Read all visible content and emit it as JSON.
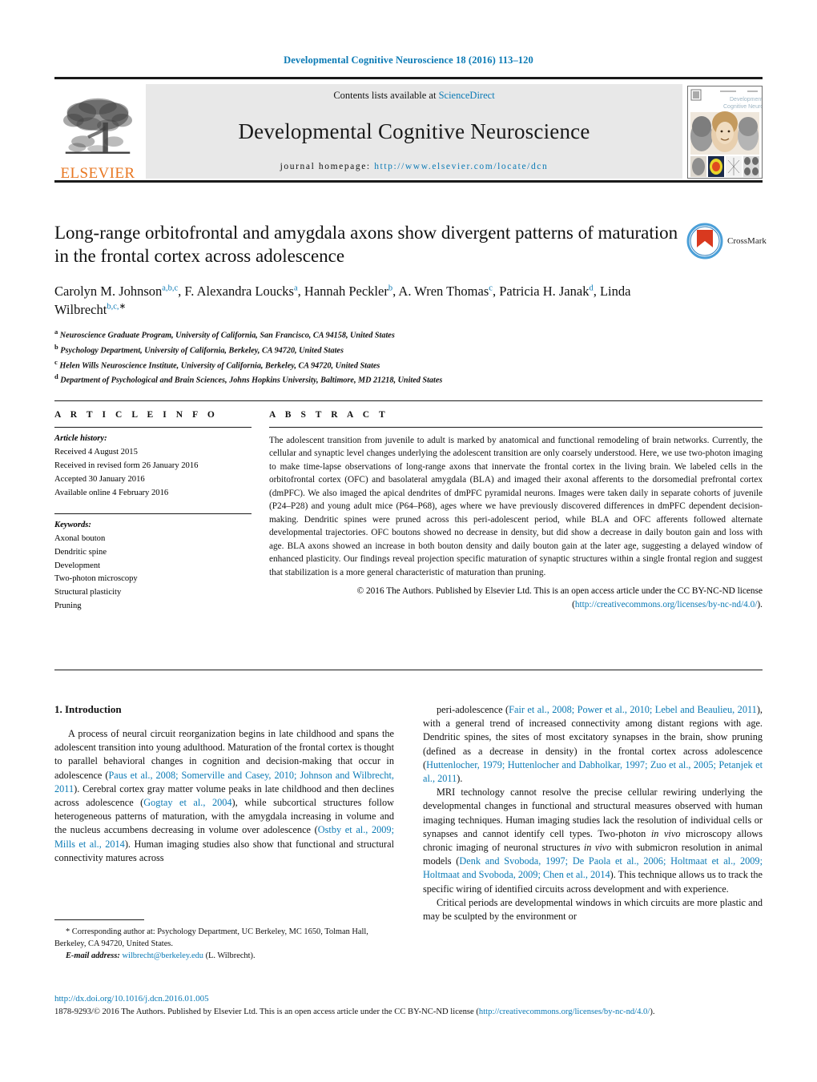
{
  "running_head": "Developmental Cognitive Neuroscience 18 (2016) 113–120",
  "masthead": {
    "contents_prefix": "Contents lists available at ",
    "contents_link": "ScienceDirect",
    "journal_title": "Developmental Cognitive Neuroscience",
    "homepage_prefix": "journal homepage: ",
    "homepage_link": "http://www.elsevier.com/locate/dcn",
    "publisher_wordmark": "ELSEVIER",
    "publisher_logo_icon": "elsevier-tree-icon",
    "cover_icon": "journal-cover-thumbnail"
  },
  "crossmark": {
    "label": "CrossMark",
    "icon": "crossmark-icon"
  },
  "article": {
    "title": "Long-range orbitofrontal and amygdala axons show divergent patterns of maturation in the frontal cortex across adolescence",
    "authors_html": "Carolyn M. Johnson<sup>a,b,c</sup>, F. Alexandra Loucks<sup>a</sup>, Hannah Peckler<sup>b</sup>, A. Wren Thomas<sup>c</sup>, Patricia H. Janak<sup>d</sup>, Linda Wilbrecht<sup>b,c,</sup><sup style=\"color:#111\">∗</sup>",
    "affiliations": [
      {
        "marker": "a",
        "text": "Neuroscience Graduate Program, University of California, San Francisco, CA 94158, United States"
      },
      {
        "marker": "b",
        "text": "Psychology Department, University of California, Berkeley, CA 94720, United States"
      },
      {
        "marker": "c",
        "text": "Helen Wills Neuroscience Institute, University of California, Berkeley, CA 94720, United States"
      },
      {
        "marker": "d",
        "text": "Department of Psychological and Brain Sciences, Johns Hopkins University, Baltimore, MD 21218, United States"
      }
    ]
  },
  "article_info": {
    "heading": "A R T I C L E    I N F O",
    "history_label": "Article history:",
    "history": [
      "Received 4 August 2015",
      "Received in revised form 26 January 2016",
      "Accepted 30 January 2016",
      "Available online 4 February 2016"
    ],
    "keywords_label": "Keywords:",
    "keywords": [
      "Axonal bouton",
      "Dendritic spine",
      "Development",
      "Two-photon microscopy",
      "Structural plasticity",
      "Pruning"
    ]
  },
  "abstract": {
    "heading": "A B S T R A C T",
    "body": "The adolescent transition from juvenile to adult is marked by anatomical and functional remodeling of brain networks. Currently, the cellular and synaptic level changes underlying the adolescent transition are only coarsely understood. Here, we use two-photon imaging to make time-lapse observations of long-range axons that innervate the frontal cortex in the living brain. We labeled cells in the orbitofrontal cortex (OFC) and basolateral amygdala (BLA) and imaged their axonal afferents to the dorsomedial prefrontal cortex (dmPFC). We also imaged the apical dendrites of dmPFC pyramidal neurons. Images were taken daily in separate cohorts of juvenile (P24–P28) and young adult mice (P64–P68), ages where we have previously discovered differences in dmPFC dependent decision-making. Dendritic spines were pruned across this peri-adolescent period, while BLA and OFC afferents followed alternate developmental trajectories. OFC boutons showed no decrease in density, but did show a decrease in daily bouton gain and loss with age. BLA axons showed an increase in both bouton density and daily bouton gain at the later age, suggesting a delayed window of enhanced plasticity. Our findings reveal projection specific maturation of synaptic structures within a single frontal region and suggest that stabilization is a more general characteristic of maturation than pruning.",
    "copyright_text": "© 2016 The Authors. Published by Elsevier Ltd. This is an open access article under the CC BY-NC-ND license (",
    "copyright_link": "http://creativecommons.org/licenses/by-nc-nd/4.0/",
    "copyright_tail": ")."
  },
  "introduction": {
    "heading": "1.  Introduction",
    "left_para_1_html": "A process of neural circuit reorganization begins in late childhood and spans the adolescent transition into young adulthood. Maturation of the frontal cortex is thought to parallel behavioral changes in cognition and decision-making that occur in adolescence (<a class=\"cite\" href=\"#\" data-name=\"citation-link\" data-interactable=\"true\">Paus et al., 2008; Somerville and Casey, 2010; Johnson and Wilbrecht, 2011</a>). Cerebral cortex gray matter volume peaks in late childhood and then declines across adolescence (<a class=\"cite\" href=\"#\" data-name=\"citation-link\" data-interactable=\"true\">Gogtay et al., 2004</a>), while subcortical structures follow heterogeneous patterns of maturation, with the amygdala increasing in volume and the nucleus accumbens decreasing in volume over adolescence (<a class=\"cite\" href=\"#\" data-name=\"citation-link\" data-interactable=\"true\">Ostby et al., 2009; Mills et al., 2014</a>). Human imaging studies also show that functional and structural connectivity matures across",
    "right_para_1_html": "peri-adolescence (<a class=\"cite\" href=\"#\" data-name=\"citation-link\" data-interactable=\"true\">Fair et al., 2008; Power et al., 2010; Lebel and Beaulieu, 2011</a>), with a general trend of increased connectivity among distant regions with age. Dendritic spines, the sites of most excitatory synapses in the brain, show pruning (defined as a decrease in density) in the frontal cortex across adolescence (<a class=\"cite\" href=\"#\" data-name=\"citation-link\" data-interactable=\"true\">Huttenlocher, 1979; Huttenlocher and Dabholkar, 1997; Zuo et al., 2005; Petanjek et al., 2011</a>).",
    "right_para_2_html": "MRI technology cannot resolve the precise cellular rewiring underlying the developmental changes in functional and structural measures observed with human imaging techniques. Human imaging studies lack the resolution of individual cells or synapses and cannot identify cell types. Two-photon <em>in vivo</em> microscopy allows chronic imaging of neuronal structures <em>in vivo</em> with submicron resolution in animal models (<a class=\"cite\" href=\"#\" data-name=\"citation-link\" data-interactable=\"true\">Denk and Svoboda, 1997; De Paola et al., 2006; Holtmaat et al., 2009; Holtmaat and Svoboda, 2009; Chen et al., 2014</a>). This technique allows us to track the specific wiring of identified circuits across development and with experience.",
    "right_para_3_html": "Critical periods are developmental windows in which circuits are more plastic and may be sculpted by the environment or"
  },
  "footnote": {
    "star_line": "*  Corresponding author at: Psychology Department, UC Berkeley, MC 1650, Tolman Hall, Berkeley, CA 94720, United States.",
    "email_label": "E-mail address:",
    "email_link": "wilbrecht@berkeley.edu",
    "email_tail": " (L. Wilbrecht)."
  },
  "footer": {
    "doi_link": "http://dx.doi.org/10.1016/j.dcn.2016.01.005",
    "issn_text": "1878-9293/© 2016 The Authors. Published by Elsevier Ltd. This is an open access article under the CC BY-NC-ND license (",
    "issn_link": "http://creativecommons.org/licenses/by-nc-nd/4.0/",
    "issn_tail": ")."
  },
  "colors": {
    "link": "#0b7ab5",
    "elsevier_orange": "#E87722",
    "band_gray": "#e8e8e8"
  }
}
